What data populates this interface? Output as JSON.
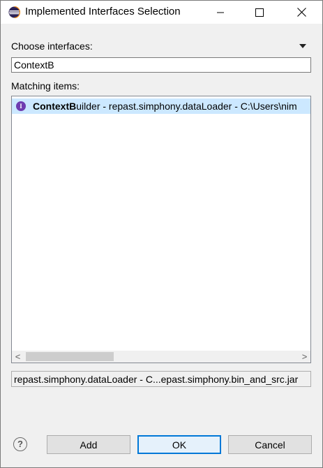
{
  "window": {
    "title": "Implemented Interfaces Selection",
    "icon": "eclipse-icon"
  },
  "titlebar_buttons": {
    "minimize": "minimize-icon",
    "maximize": "maximize-icon",
    "close": "close-icon"
  },
  "filter": {
    "label": "Choose interfaces:",
    "value": "ContextB"
  },
  "matching": {
    "label": "Matching items:",
    "items": [
      {
        "match_bold": "ContextB",
        "match_rest": "uilder",
        "detail": " - repast.simphony.dataLoader - C:\\Users\\nim",
        "icon": "interface-icon",
        "icon_letter": "I",
        "selected": true
      }
    ]
  },
  "status_text": "repast.simphony.dataLoader - C...epast.simphony.bin_and_src.jar",
  "scrollbar": {
    "left_arrow": "<",
    "right_arrow": ">"
  },
  "help": {
    "symbol": "?",
    "icon": "help-icon"
  },
  "buttons": {
    "add": "Add",
    "ok": "OK",
    "cancel": "Cancel"
  },
  "colors": {
    "selection": "#cce8ff",
    "interface_icon": "#6e3cb0",
    "default_button_border": "#0078d7"
  }
}
